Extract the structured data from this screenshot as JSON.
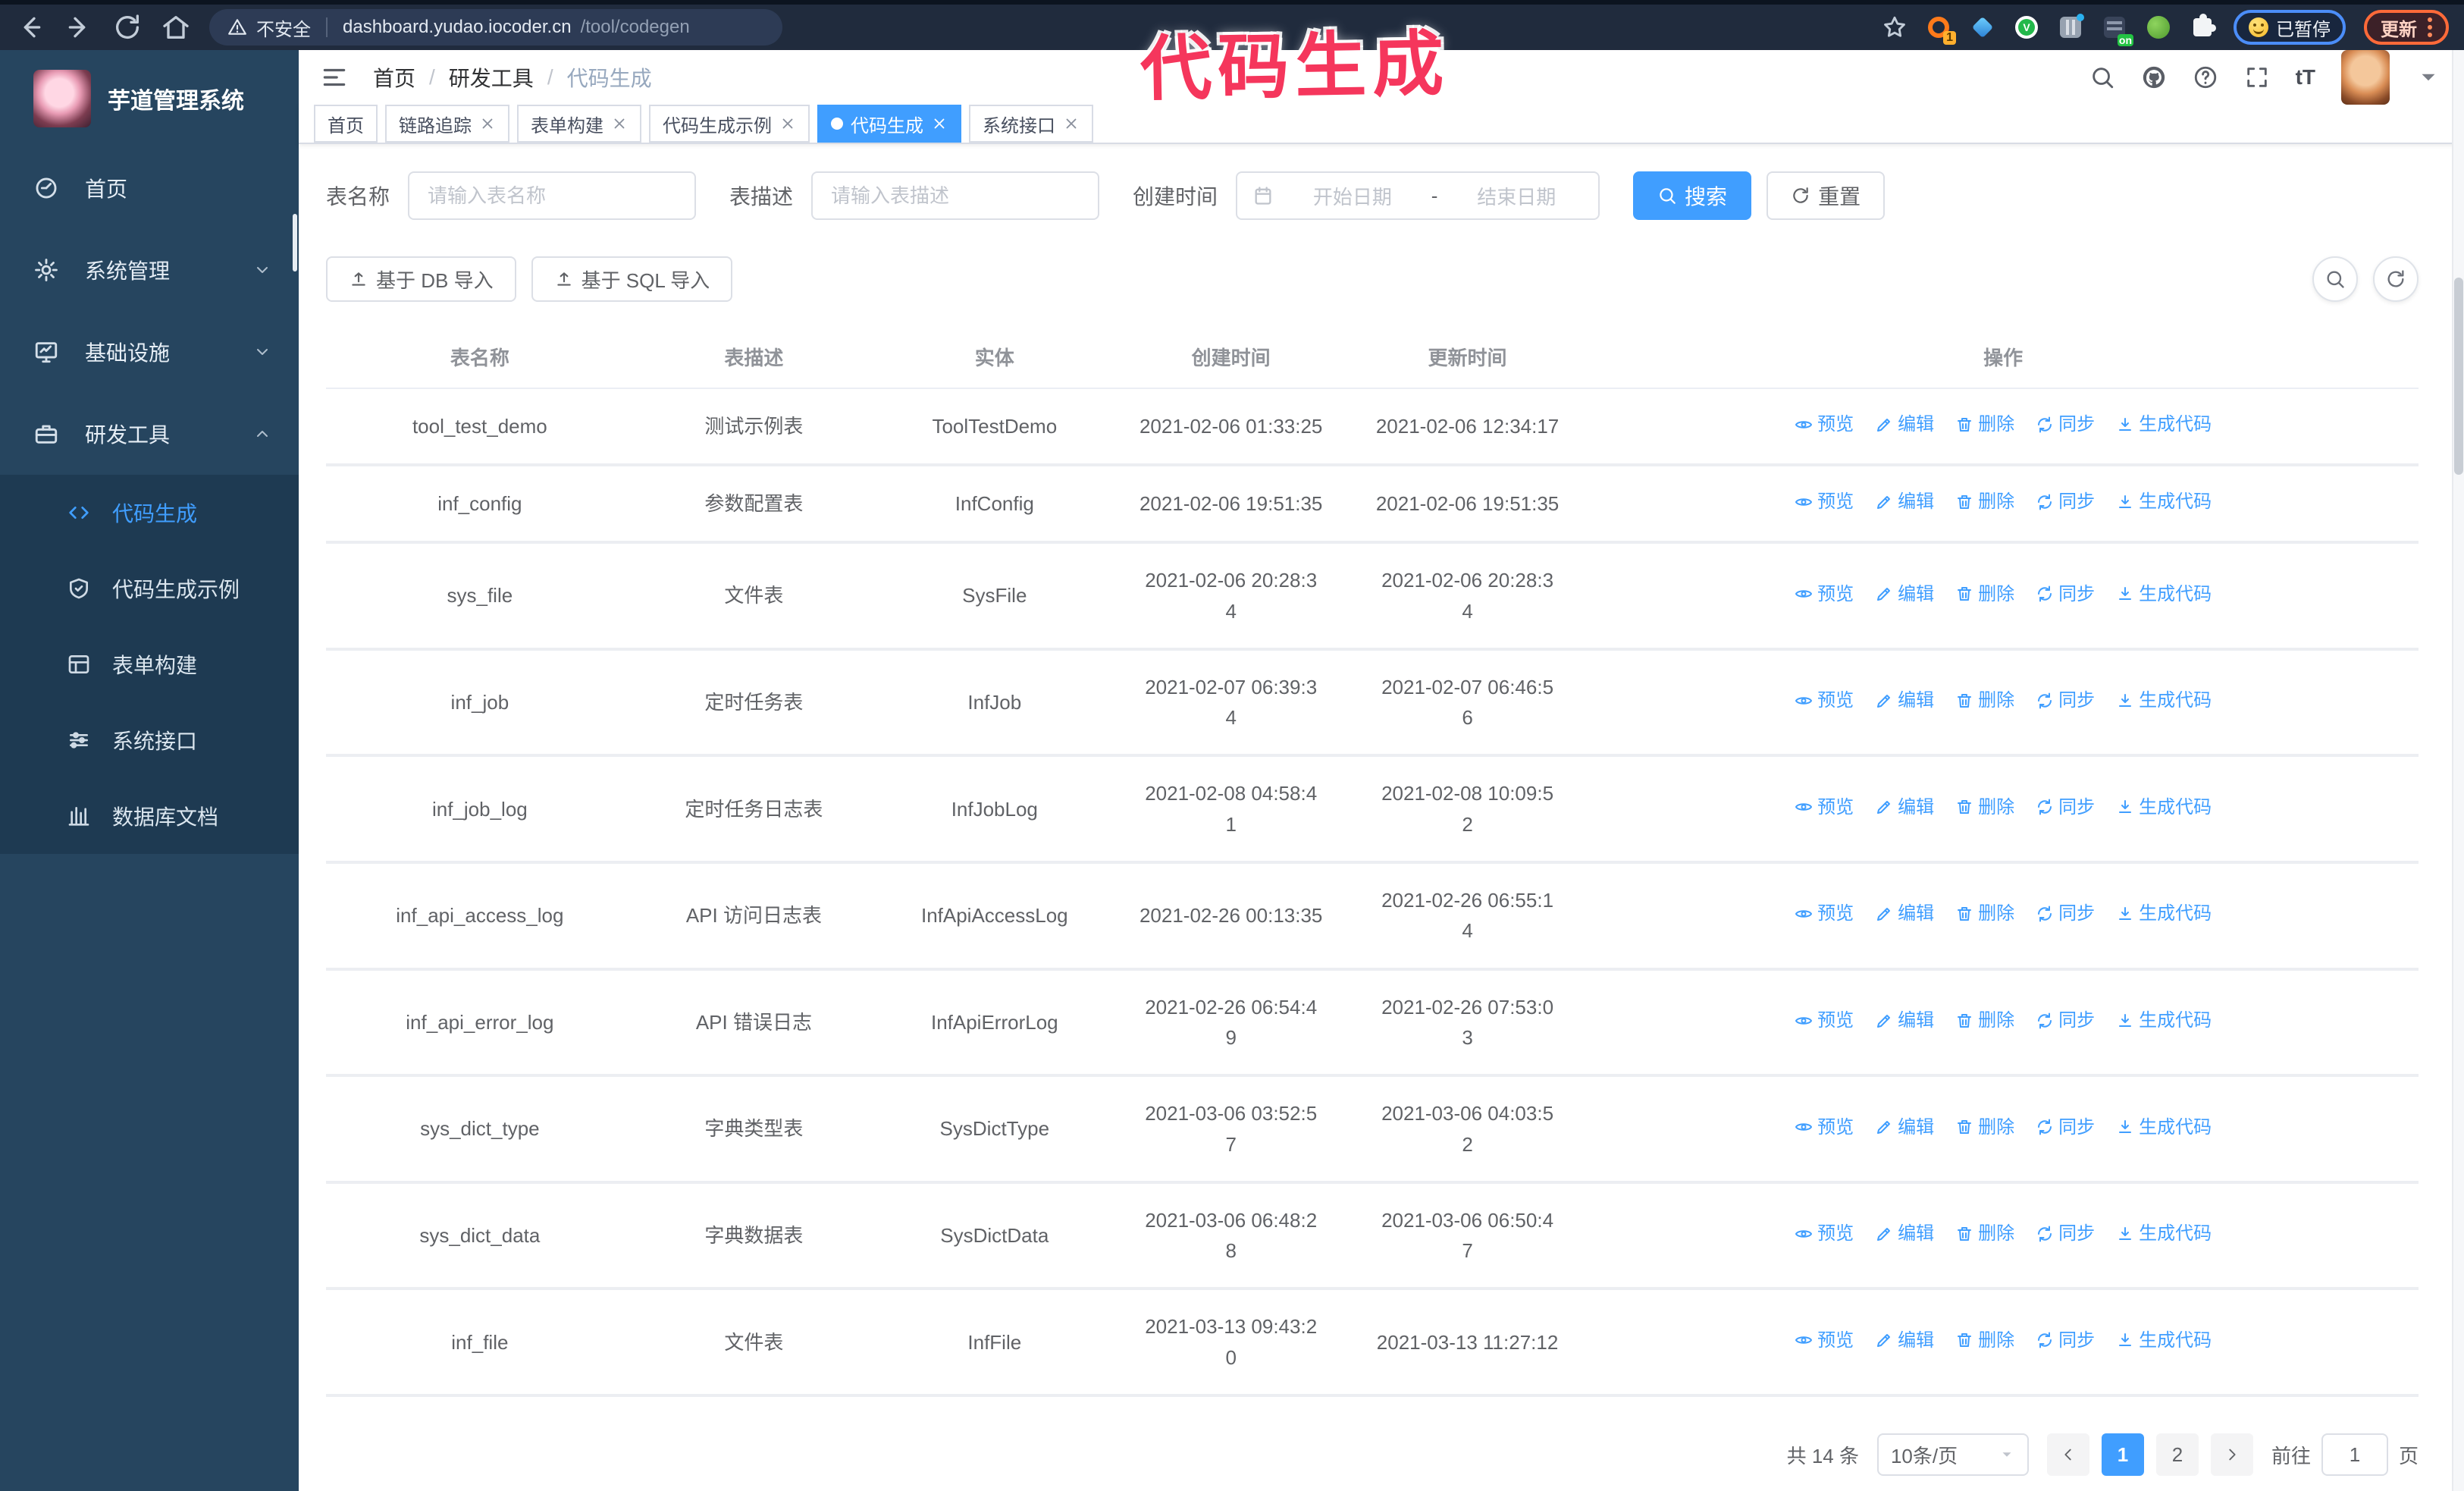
{
  "colors": {
    "accent": "#409eff",
    "watermark": "#f5365c",
    "sidebar_bg": "#26455f",
    "submenu_bg": "#1e3a52",
    "update_orange": "#ff6a39",
    "paused_blue": "#4b8df8"
  },
  "browser": {
    "security_label": "不安全",
    "url_host": "dashboard.yudao.iocoder.cn",
    "url_path": "/tool/codegen",
    "extension_badge": "1",
    "on_badge": "on",
    "v_badge": "V",
    "paused_label": "已暂停",
    "update_label": "更新"
  },
  "watermark": "代码生成",
  "sidebar": {
    "title": "芋道管理系统",
    "menu": [
      {
        "name": "sidebar-item-home",
        "label": "首页",
        "icon": "dashboard-icon",
        "chevron": null
      },
      {
        "name": "sidebar-item-system",
        "label": "系统管理",
        "icon": "gear-icon",
        "chevron": "down"
      },
      {
        "name": "sidebar-item-infra",
        "label": "基础设施",
        "icon": "monitor-icon",
        "chevron": "down"
      },
      {
        "name": "sidebar-item-devtools",
        "label": "研发工具",
        "icon": "toolbox-icon",
        "chevron": "up"
      }
    ],
    "submenu": [
      {
        "name": "sidebar-subitem-codegen",
        "label": "代码生成",
        "icon": "code-icon",
        "active": true
      },
      {
        "name": "sidebar-subitem-codegen-demo",
        "label": "代码生成示例",
        "icon": "shield-icon",
        "active": false
      },
      {
        "name": "sidebar-subitem-form-builder",
        "label": "表单构建",
        "icon": "form-icon",
        "active": false
      },
      {
        "name": "sidebar-subitem-api",
        "label": "系统接口",
        "icon": "sliders-icon",
        "active": false
      },
      {
        "name": "sidebar-subitem-db-doc",
        "label": "数据库文档",
        "icon": "database-doc-icon",
        "active": false
      }
    ]
  },
  "header": {
    "breadcrumb": [
      "首页",
      "研发工具",
      "代码生成"
    ],
    "breadcrumb_separator": "/",
    "font_icon_label": "tT"
  },
  "tags": [
    {
      "name": "tag-home",
      "label": "首页",
      "closable": false,
      "active": false
    },
    {
      "name": "tag-tracing",
      "label": "链路追踪",
      "closable": true,
      "active": false
    },
    {
      "name": "tag-form-builder",
      "label": "表单构建",
      "closable": true,
      "active": false
    },
    {
      "name": "tag-codegen-demo",
      "label": "代码生成示例",
      "closable": true,
      "active": false
    },
    {
      "name": "tag-codegen",
      "label": "代码生成",
      "closable": true,
      "active": true
    },
    {
      "name": "tag-api",
      "label": "系统接口",
      "closable": true,
      "active": false
    }
  ],
  "filters": {
    "table_name_label": "表名称",
    "table_name_placeholder": "请输入表名称",
    "table_desc_label": "表描述",
    "table_desc_placeholder": "请输入表描述",
    "create_time_label": "创建时间",
    "date_start_placeholder": "开始日期",
    "date_separator": "-",
    "date_end_placeholder": "结束日期",
    "search_label": "搜索",
    "reset_label": "重置"
  },
  "toolbar": {
    "import_db_label": "基于 DB 导入",
    "import_sql_label": "基于 SQL 导入"
  },
  "table": {
    "columns": [
      "表名称",
      "表描述",
      "实体",
      "创建时间",
      "更新时间",
      "操作"
    ],
    "action_labels": [
      "预览",
      "编辑",
      "删除",
      "同步",
      "生成代码"
    ],
    "rows": [
      {
        "name": "tool_test_demo",
        "desc": "测试示例表",
        "entity": "ToolTestDemo",
        "created": "2021-02-06 01:33:25",
        "updated": "2021-02-06 12:34:17"
      },
      {
        "name": "inf_config",
        "desc": "参数配置表",
        "entity": "InfConfig",
        "created": "2021-02-06 19:51:35",
        "updated": "2021-02-06 19:51:35"
      },
      {
        "name": "sys_file",
        "desc": "文件表",
        "entity": "SysFile",
        "created": "2021-02-06 20:28:3\n4",
        "updated": "2021-02-06 20:28:3\n4"
      },
      {
        "name": "inf_job",
        "desc": "定时任务表",
        "entity": "InfJob",
        "created": "2021-02-07 06:39:3\n4",
        "updated": "2021-02-07 06:46:5\n6"
      },
      {
        "name": "inf_job_log",
        "desc": "定时任务日志表",
        "entity": "InfJobLog",
        "created": "2021-02-08 04:58:4\n1",
        "updated": "2021-02-08 10:09:5\n2"
      },
      {
        "name": "inf_api_access_log",
        "desc": "API 访问日志表",
        "entity": "InfApiAccessLog",
        "created": "2021-02-26 00:13:35",
        "updated": "2021-02-26 06:55:1\n4"
      },
      {
        "name": "inf_api_error_log",
        "desc": "API 错误日志",
        "entity": "InfApiErrorLog",
        "created": "2021-02-26 06:54:4\n9",
        "updated": "2021-02-26 07:53:0\n3"
      },
      {
        "name": "sys_dict_type",
        "desc": "字典类型表",
        "entity": "SysDictType",
        "created": "2021-03-06 03:52:5\n7",
        "updated": "2021-03-06 04:03:5\n2"
      },
      {
        "name": "sys_dict_data",
        "desc": "字典数据表",
        "entity": "SysDictData",
        "created": "2021-03-06 06:48:2\n8",
        "updated": "2021-03-06 06:50:4\n7"
      },
      {
        "name": "inf_file",
        "desc": "文件表",
        "entity": "InfFile",
        "created": "2021-03-13 09:43:2\n0",
        "updated": "2021-03-13 11:27:12"
      }
    ]
  },
  "pagination": {
    "total_label": "共 14 条",
    "page_size_label": "10条/页",
    "pages": [
      "1",
      "2"
    ],
    "active_page": "1",
    "goto_label": "前往",
    "goto_value": "1",
    "page_suffix": "页"
  }
}
